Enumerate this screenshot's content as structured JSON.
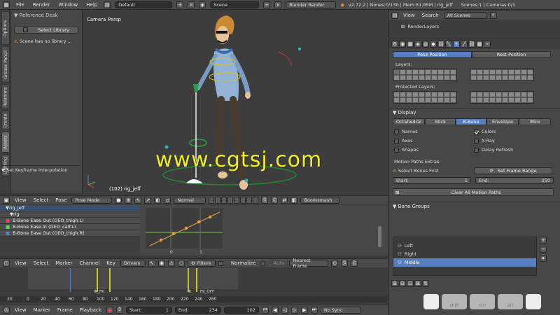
{
  "topbar": {
    "menus": [
      "File",
      "Render",
      "Window",
      "Help"
    ],
    "layout": "Default",
    "scene": "Scene",
    "engine": "Blender Render",
    "stats": "v2.72.2 | Bones:0/130 | Mem:51.85M | rig_jeff",
    "stats2": "Scenes:1 | Cameras:0/1"
  },
  "toolshelf": {
    "tabs": [
      "Options",
      "Grease Pencil",
      "Relations",
      "Create",
      "Assets",
      "Lighting"
    ],
    "reference_desk": "Reference Desk",
    "select_library": "Select Library",
    "warning": "Scene has no library ...",
    "operator": "Set Keyframe Interpolation"
  },
  "viewport": {
    "label": "Camera Persp",
    "frame_label": "(102) rig_jeff",
    "watermark": "www.cgtsj.com",
    "header": {
      "view": "View",
      "select": "Select",
      "pose": "Pose",
      "mode": "Pose Mode",
      "pivot": "Normal",
      "rig": "Boomsmash"
    }
  },
  "graph": {
    "channels": [
      {
        "label": "rig_jeff"
      },
      {
        "label": "rig"
      },
      {
        "label": "B-Bone Ease Out (GEO_thigh.L)"
      },
      {
        "label": "B-Bone Ease In (GEO_calf.L)"
      },
      {
        "label": "B-Bone Ease Out (GEO_thigh.R)"
      }
    ],
    "ticks": [
      "0",
      "1"
    ]
  },
  "dopesheet": {
    "menus": [
      "View",
      "Select",
      "Marker",
      "Channel",
      "Key"
    ],
    "mode": "Drivers",
    "filters": "Filters",
    "normalize": "Normalize",
    "auto": "Auto",
    "nearest": "Nearest Frame",
    "markers": [
      "IK_FK",
      "IK",
      "FK_OFF"
    ],
    "ruler": [
      "20",
      "0",
      "20",
      "40",
      "60",
      "80",
      "100",
      "120",
      "140",
      "160",
      "180",
      "200",
      "220",
      "240",
      "260"
    ]
  },
  "timeline": {
    "menus": [
      "View",
      "Marker",
      "Frame",
      "Playback"
    ],
    "start_label": "Start:",
    "start": "1",
    "end_label": "End:",
    "end": "234",
    "current": "102",
    "sync": "No Sync"
  },
  "outliner": {
    "view": "View",
    "search": "Search",
    "scope": "All Scenes",
    "render_layers": "RenderLayers"
  },
  "properties": {
    "pose_position": "Pose Position",
    "rest_position": "Rest Position",
    "layers_label": "Layers:",
    "protected_label": "Protected Layers:",
    "display_label": "Display",
    "display_tabs": [
      "Octahedral",
      "Stick",
      "B-Bone",
      "Envelope",
      "Wire"
    ],
    "display_active": "B-Bone",
    "checks_left": [
      {
        "label": "Names",
        "on": false
      },
      {
        "label": "Axes",
        "on": false
      },
      {
        "label": "Shapes",
        "on": false
      }
    ],
    "checks_right": [
      {
        "label": "Colors",
        "on": true
      },
      {
        "label": "X-Ray",
        "on": false
      },
      {
        "label": "Delay Refresh",
        "on": false
      }
    ],
    "motion_extras": "Motion Paths Extras:",
    "select_bones_first": "Select Bones First",
    "set_frame_range": "Set Frame Range",
    "start_label": "Start:",
    "start": "1",
    "end_label": "End:",
    "end": "250",
    "clear_paths": "Clear All Motion Paths",
    "bone_groups_label": "Bone Groups",
    "bone_groups": [
      {
        "label": "Left",
        "selected": false
      },
      {
        "label": "Right",
        "selected": false
      },
      {
        "label": "Middle",
        "selected": true
      }
    ]
  },
  "overlay_keys": [
    "shift",
    "ctrl",
    "alt"
  ],
  "colors": {
    "accent": "#5680c2",
    "watermark": "#f2ee1a",
    "orange": "#e8a040"
  }
}
